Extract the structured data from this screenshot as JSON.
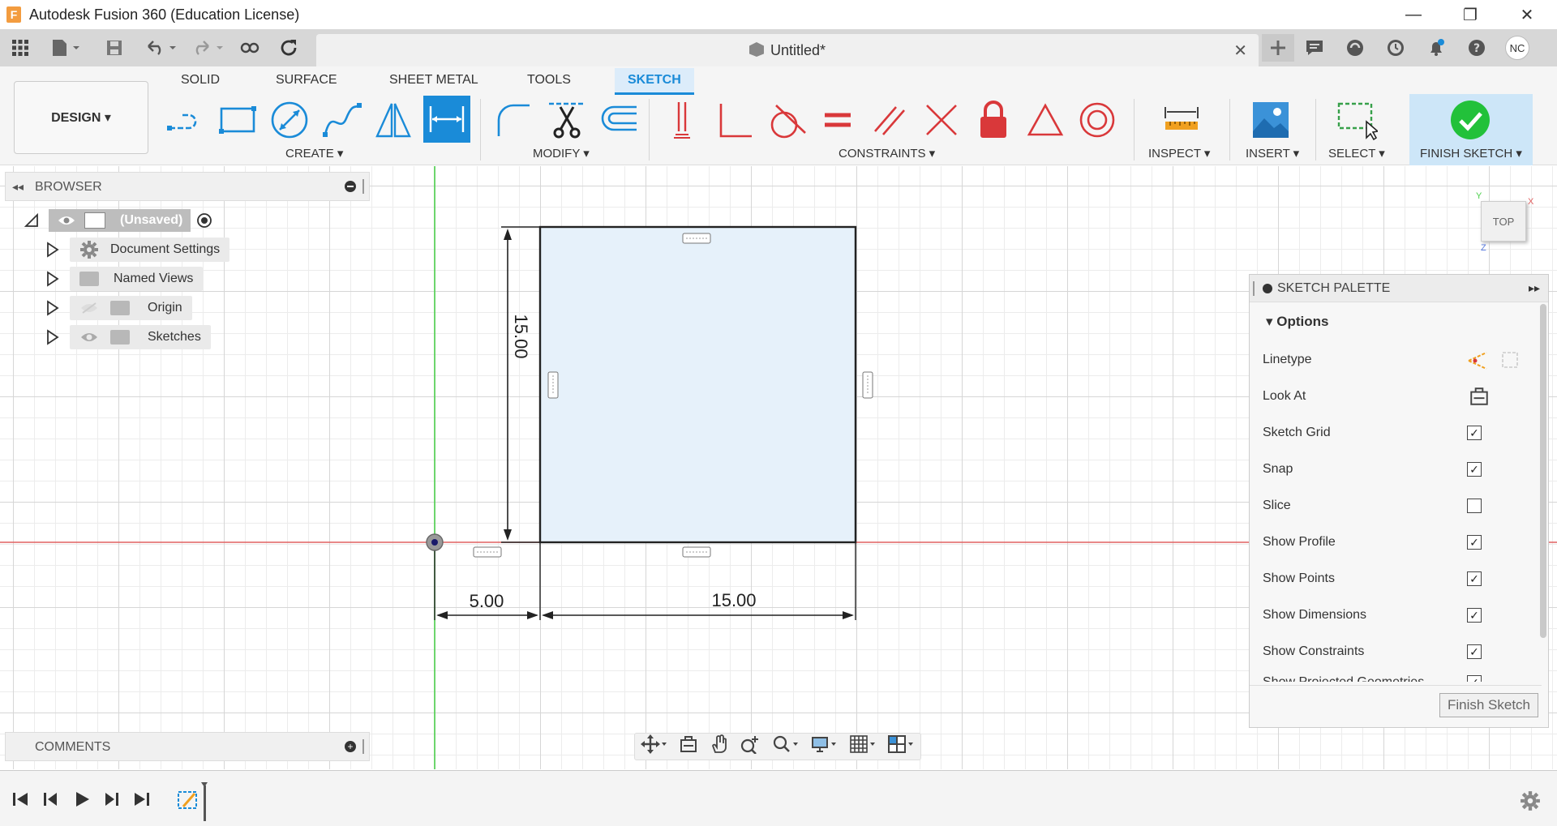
{
  "window": {
    "title": "Autodesk Fusion 360 (Education License)",
    "app_icon_letter": "F",
    "controls": [
      "—",
      "❐",
      "✕"
    ]
  },
  "document": {
    "tab_title": "Untitled*",
    "user_initials": "NC"
  },
  "ribbon": {
    "workspace": "DESIGN ▾",
    "tabs": [
      "SOLID",
      "SURFACE",
      "SHEET METAL",
      "TOOLS",
      "SKETCH"
    ],
    "active_tab": "SKETCH",
    "groups": {
      "create": "CREATE ▾",
      "modify": "MODIFY ▾",
      "constraints": "CONSTRAINTS ▾",
      "inspect": "INSPECT ▾",
      "insert": "INSERT ▾",
      "select": "SELECT ▾",
      "finish": "FINISH SKETCH ▾"
    }
  },
  "browser": {
    "header": "BROWSER",
    "root": "(Unsaved)",
    "items": [
      {
        "label": "Document Settings"
      },
      {
        "label": "Named Views"
      },
      {
        "label": "Origin"
      },
      {
        "label": "Sketches"
      }
    ]
  },
  "comments": {
    "header": "COMMENTS"
  },
  "sketch": {
    "dim_height": "15.00",
    "dim_offset": "5.00",
    "dim_width": "15.00"
  },
  "viewcube": {
    "face": "TOP",
    "axis_x": "X",
    "axis_y": "Y",
    "axis_z": "Z"
  },
  "palette": {
    "header": "SKETCH PALETTE",
    "section": "Options",
    "rows": [
      {
        "label": "Linetype",
        "type": "icons"
      },
      {
        "label": "Look At",
        "type": "icon"
      },
      {
        "label": "Sketch Grid",
        "checked": "✓"
      },
      {
        "label": "Snap",
        "checked": "✓"
      },
      {
        "label": "Slice",
        "checked": ""
      },
      {
        "label": "Show Profile",
        "checked": "✓"
      },
      {
        "label": "Show Points",
        "checked": "✓"
      },
      {
        "label": "Show Dimensions",
        "checked": "✓"
      },
      {
        "label": "Show Constraints",
        "checked": "✓"
      },
      {
        "label": "Show Projected Geometries",
        "checked": "✓"
      }
    ],
    "finish_button": "Finish Sketch"
  },
  "colors": {
    "accent": "#1a8bd8",
    "axis_red": "#e06060",
    "axis_green": "#4cd04c",
    "profile_fill": "#e6f1fa",
    "finish_green": "#22c13a",
    "constraint_red": "#d9383a"
  }
}
